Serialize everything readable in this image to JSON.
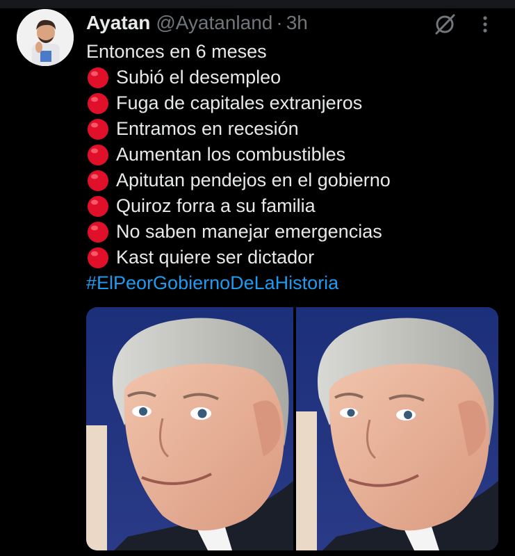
{
  "tweet": {
    "author": {
      "name": "Ayatan",
      "handle": "@Ayatanland",
      "avatar_icon": "profile-avatar"
    },
    "separator": "·",
    "time": "3h",
    "icons": {
      "grok": "grok-icon",
      "more": "more-options-icon",
      "bullet": "red-circle-emoji"
    },
    "intro": "Entonces en 6 meses",
    "items": [
      "Subió el desempleo",
      "Fuga de capitales extranjeros",
      "Entramos en recesión",
      "Aumentan los combustibles",
      "Apitutan pendejos en el gobierno",
      "Quiroz forra a su familia",
      "No saben manejar emergencias",
      "Kast quiere ser dictador"
    ],
    "hashtag": "#ElPeorGobiernoDeLaHistoria",
    "media": {
      "description_icon": "photo-two-panel-meme"
    }
  },
  "colors": {
    "background": "#000000",
    "text": "#e7e9ea",
    "secondary": "#71767b",
    "link": "#1d9bf0",
    "bullet": "#e0102a"
  }
}
